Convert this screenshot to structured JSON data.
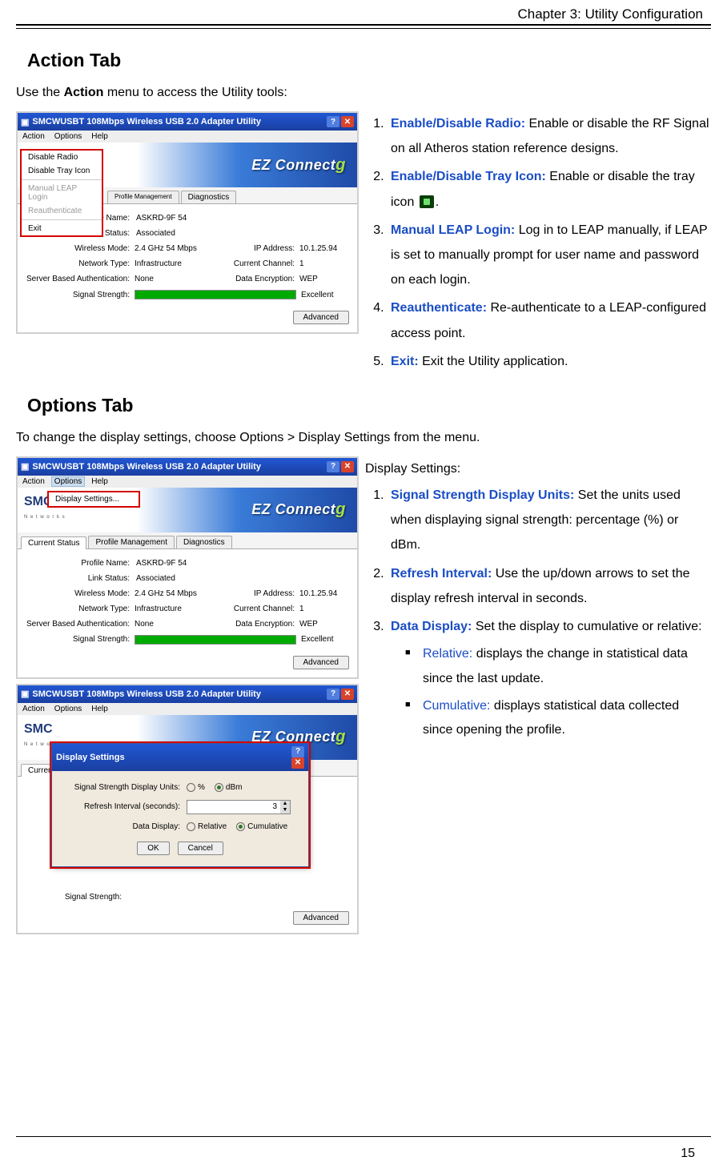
{
  "header": {
    "chapter": "Chapter 3: Utility Configuration"
  },
  "page_number": "15",
  "section1": {
    "title": "Action Tab",
    "intro_pre": "Use the ",
    "intro_bold": "Action",
    "intro_post": " menu to access the Utility tools:",
    "list": [
      {
        "term": "Enable/Disable Radio:",
        "desc": " Enable or disable the RF Signal on all Atheros station reference designs."
      },
      {
        "term": "Enable/Disable Tray Icon:",
        "desc_pre": " Enable or disable the tray icon ",
        "desc_post": "."
      },
      {
        "term": "Manual LEAP Login:",
        "desc": " Log in to LEAP manually, if LEAP is set to manually prompt for user name and password on each login."
      },
      {
        "term": "Reauthenticate:",
        "desc": " Re-authenticate to a LEAP-configured access point."
      },
      {
        "term": "Exit:",
        "desc": " Exit the Utility application."
      }
    ]
  },
  "section2": {
    "title": "Options Tab",
    "intro": "To change the display settings, choose Options > Display Settings from the menu.",
    "lead": "Display Settings:",
    "list": [
      {
        "term": "Signal Strength Display Units:",
        "desc": " Set the units used when displaying signal strength: percentage (%) or dBm."
      },
      {
        "term": "Refresh Interval:",
        "desc": " Use the up/down arrows to set the display refresh interval in seconds."
      },
      {
        "term": "Data Display:",
        "desc": " Set the display to cumulative or relative:"
      }
    ],
    "sublist": [
      {
        "term": "Relative:",
        "desc": " displays the change in statistical data since the last update."
      },
      {
        "term": "Cumulative:",
        "desc": " displays statistical data collected since opening the profile."
      }
    ]
  },
  "win": {
    "title": "SMCWUSBT 108Mbps Wireless USB 2.0 Adapter Utility",
    "menus": [
      "Action",
      "Options",
      "Help"
    ],
    "action_menu": [
      "Disable Radio",
      "Disable Tray Icon",
      "Manual LEAP Login",
      "Reauthenticate",
      "Exit"
    ],
    "options_menu": "Display Settings...",
    "banner": "EZ Connect",
    "banner_g": "g",
    "logo": "SMC",
    "logo_sub": "N e t w o r k s",
    "tabs": [
      "Current Status",
      "Profile Management",
      "Diagnostics"
    ],
    "fields": {
      "profile_name_l": "Profile Name:",
      "profile_name_v": "ASKRD-9F 54",
      "link_status_l": "Link Status:",
      "link_status_v": "Associated",
      "wmode_l": "Wireless Mode:",
      "wmode_v": "2.4 GHz 54 Mbps",
      "ip_l": "IP Address:",
      "ip_v": "10.1.25.94",
      "ntype_l": "Network Type:",
      "ntype_v": "Infrastructure",
      "chan_l": "Current Channel:",
      "chan_v": "1",
      "auth_l": "Server Based Authentication:",
      "auth_v": "None",
      "enc_l": "Data Encryption:",
      "enc_v": "WEP",
      "sig_l": "Signal Strength:",
      "sig_v": "Excellent",
      "adv_btn": "Advanced"
    },
    "dlg": {
      "title": "Display Settings",
      "ssdu_l": "Signal Strength Display Units:",
      "pct": "%",
      "dbm": "dBm",
      "refresh_l": "Refresh Interval (seconds):",
      "refresh_v": "3",
      "dd_l": "Data Display:",
      "rel": "Relative",
      "cum": "Cumulative",
      "ok": "OK",
      "cancel": "Cancel"
    }
  }
}
